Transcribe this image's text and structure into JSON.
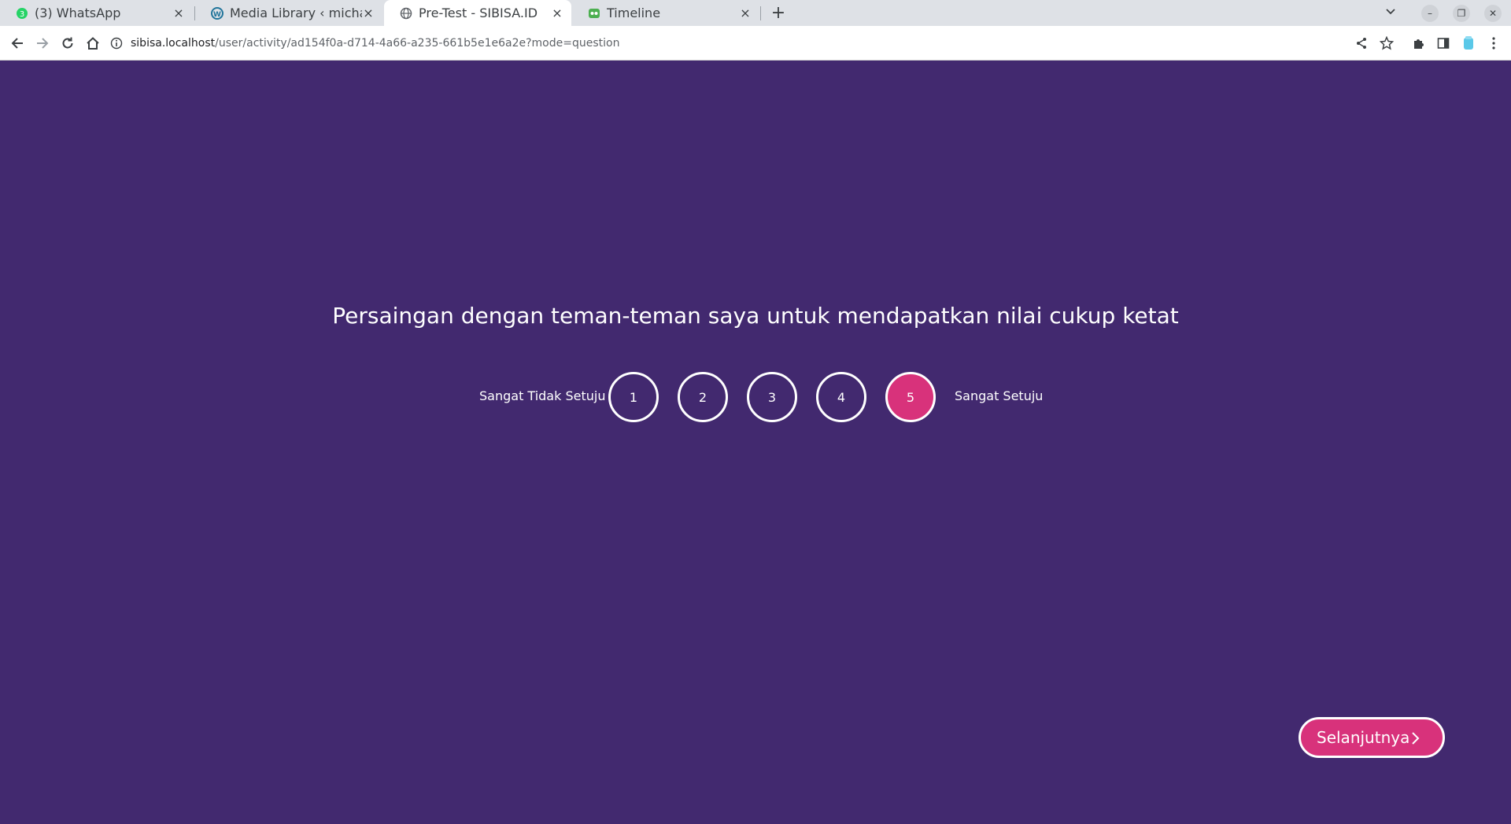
{
  "browser": {
    "tabs": [
      {
        "title": "(3) WhatsApp",
        "badge": "3"
      },
      {
        "title": "Media Library ‹ michaelrk"
      },
      {
        "title": "Pre-Test - SIBISA.ID"
      },
      {
        "title": "Timeline"
      }
    ],
    "url_host": "sibisa.localhost",
    "url_path": "/user/activity/ad154f0a-d714-4a66-a235-661b5e1e6a2e?mode=question"
  },
  "quiz": {
    "question": "Persaingan dengan teman-teman saya untuk mendapatkan nilai cukup ketat",
    "label_low": "Sangat Tidak Setuju",
    "label_high": "Sangat Setuju",
    "options": [
      "1",
      "2",
      "3",
      "4",
      "5"
    ],
    "selected": "5",
    "next_label": "Selanjutnya"
  },
  "colors": {
    "background": "#42296f",
    "accent": "#d8327b"
  }
}
